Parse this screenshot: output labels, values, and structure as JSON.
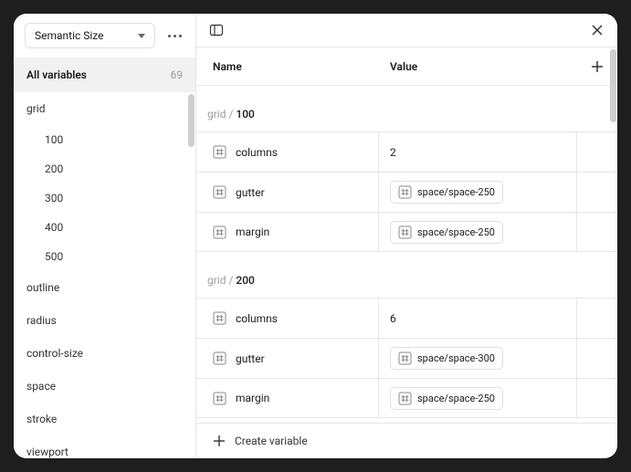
{
  "collection": {
    "name": "Semantic Size"
  },
  "allVariables": {
    "label": "All variables",
    "count": "69"
  },
  "sidebarGroups": [
    {
      "label": "grid",
      "children": [
        "100",
        "200",
        "300",
        "400",
        "500"
      ]
    },
    {
      "label": "outline"
    },
    {
      "label": "radius"
    },
    {
      "label": "control-size"
    },
    {
      "label": "space"
    },
    {
      "label": "stroke"
    },
    {
      "label": "viewport"
    }
  ],
  "columns": {
    "name": "Name",
    "value": "Value"
  },
  "groups": [
    {
      "prefix": "grid",
      "name": "100",
      "rows": [
        {
          "name": "columns",
          "valueType": "number",
          "value": "2"
        },
        {
          "name": "gutter",
          "valueType": "alias",
          "value": "space/space-250"
        },
        {
          "name": "margin",
          "valueType": "alias",
          "value": "space/space-250"
        }
      ]
    },
    {
      "prefix": "grid",
      "name": "200",
      "rows": [
        {
          "name": "columns",
          "valueType": "number",
          "value": "6"
        },
        {
          "name": "gutter",
          "valueType": "alias",
          "value": "space/space-300"
        },
        {
          "name": "margin",
          "valueType": "alias",
          "value": "space/space-250"
        }
      ]
    }
  ],
  "footer": {
    "createVariable": "Create variable"
  }
}
